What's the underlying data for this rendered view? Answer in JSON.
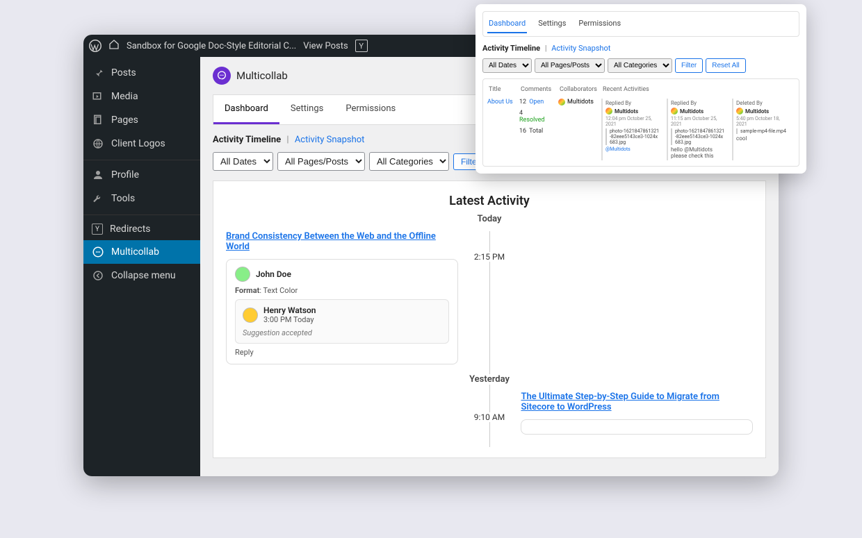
{
  "adminbar": {
    "site_title": "Sandbox for Google Doc-Style Editorial C...",
    "view_posts": "View Posts"
  },
  "sidebar": {
    "posts": "Posts",
    "media": "Media",
    "pages": "Pages",
    "client_logos": "Client Logos",
    "profile": "Profile",
    "tools": "Tools",
    "redirects": "Redirects",
    "multicollab": "Multicollab",
    "collapse": "Collapse menu"
  },
  "brand": {
    "name": "Multicollab"
  },
  "tabs": {
    "dashboard": "Dashboard",
    "settings": "Settings",
    "permissions": "Permissions"
  },
  "subnav": {
    "timeline": "Activity Timeline",
    "snapshot": "Activity Snapshot"
  },
  "filters": {
    "dates": "All Dates",
    "pages": "All Pages/Posts",
    "categories": "All Categories",
    "filter": "Filter"
  },
  "activity": {
    "heading": "Latest Activity",
    "today": "Today",
    "yesterday": "Yesterday",
    "entry1": {
      "time": "2:15 PM",
      "post_title": "Brand Consistency Between the Web and the Offline World",
      "author": "John Doe",
      "format_label": "Format",
      "format_value": ": Text Color",
      "reply_author": "Henry Watson",
      "reply_time": "3:00 PM Today",
      "reply_status": "Suggestion accepted",
      "reply_action": "Reply"
    },
    "entry2": {
      "time": "9:10 AM",
      "post_title": "The Ultimate Step-by-Step Guide to Migrate from Sitecore to WordPress"
    }
  },
  "popup": {
    "tabs": {
      "dashboard": "Dashboard",
      "settings": "Settings",
      "permissions": "Permissions"
    },
    "subnav": {
      "timeline": "Activity Timeline",
      "snapshot": "Activity Snapshot"
    },
    "filters": {
      "dates": "All Dates",
      "pages": "All Pages/Posts",
      "categories": "All Categories",
      "filter": "Filter",
      "reset": "Reset All"
    },
    "thead": {
      "title": "Title",
      "comments": "Comments",
      "collaborators": "Collaborators",
      "recent": "Recent Activities"
    },
    "row": {
      "title": "About Us",
      "open_n": "12",
      "open_l": "Open",
      "res_n": "4",
      "res_l": "Resolved",
      "tot_n": "16",
      "tot_l": "Total",
      "collab": "Multidots",
      "c1": {
        "h": "Replied By",
        "u": "Multidots",
        "ts": "12:04 pm October 25, 2021",
        "file": "photo-1621847861321-82eee5143ce3-1024x683.jpg",
        "m": "@Multidots"
      },
      "c2": {
        "h": "Replied By",
        "u": "Multidots",
        "ts": "11:15 am October 25, 2021",
        "file": "photo-1621847861321-82eee5143ce3-1024x683.jpg",
        "m": "hello @Multidots please check this"
      },
      "c3": {
        "h": "Deleted By",
        "u": "Multidots",
        "ts": "5:40 pm October 18, 2021",
        "file": "sample-mp4-file.mp4",
        "m": "cool"
      }
    }
  }
}
